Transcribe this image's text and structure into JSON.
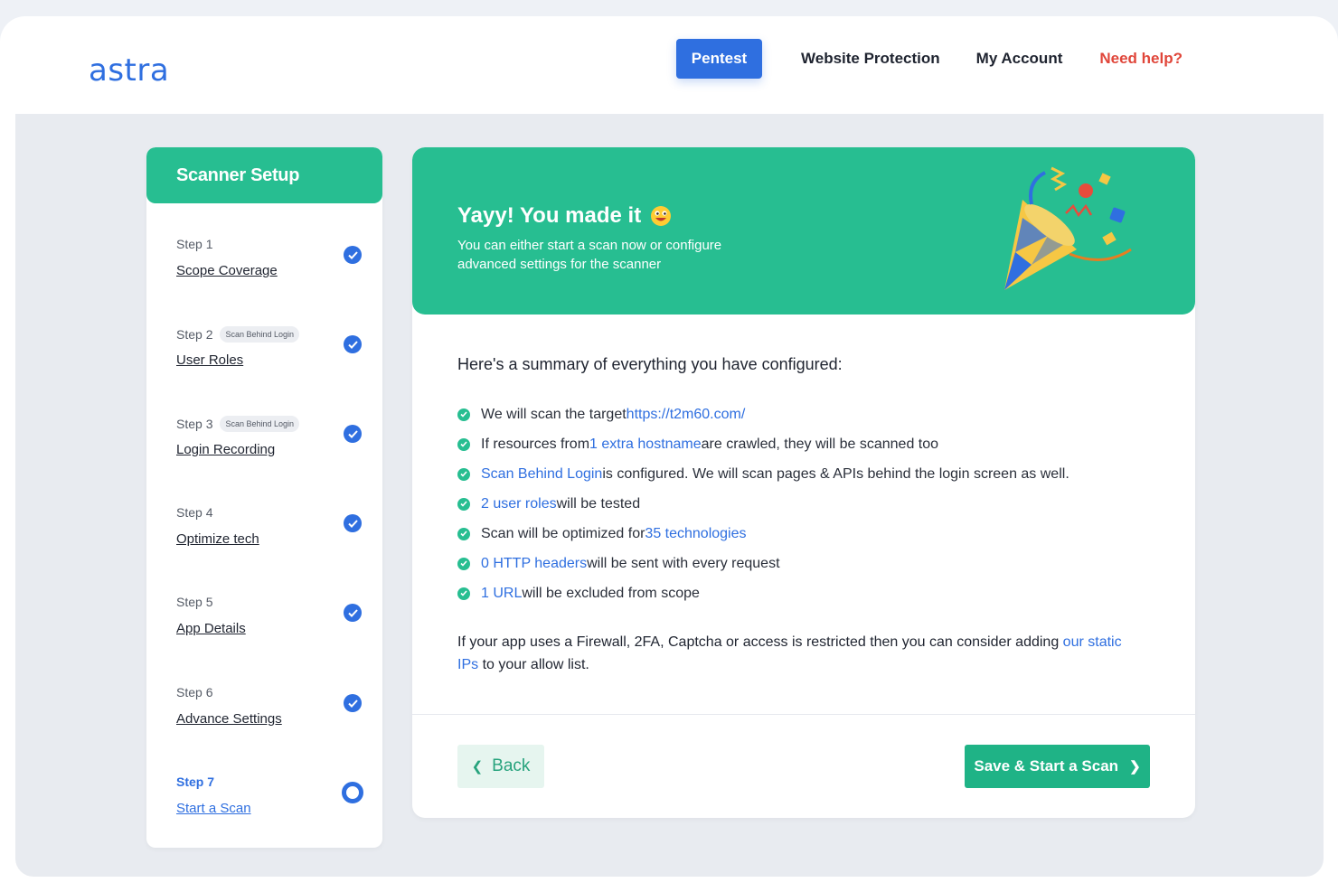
{
  "brand": {
    "logo_text": "astra",
    "accent": "#2f6fe0",
    "green": "#27be91",
    "help_color": "#e0463a"
  },
  "nav": {
    "pentest": "Pentest",
    "website_protection": "Website Protection",
    "my_account": "My Account",
    "need_help": "Need help?"
  },
  "sidebar": {
    "title": "Scanner Setup",
    "steps": [
      {
        "step": "Step 1",
        "badge": "",
        "label": "Scope Coverage",
        "state": "done"
      },
      {
        "step": "Step 2",
        "badge": "Scan Behind Login",
        "label": "User Roles",
        "state": "done"
      },
      {
        "step": "Step 3",
        "badge": "Scan Behind Login",
        "label": "Login Recording",
        "state": "done"
      },
      {
        "step": "Step 4",
        "badge": "",
        "label": "Optimize tech",
        "state": "done"
      },
      {
        "step": "Step 5",
        "badge": "",
        "label": "App Details",
        "state": "done"
      },
      {
        "step": "Step 6",
        "badge": "",
        "label": "Advance Settings",
        "state": "done"
      },
      {
        "step": "Step 7",
        "badge": "",
        "label": "Start a Scan",
        "state": "active"
      }
    ]
  },
  "banner": {
    "title": "Yayy! You made it",
    "subtitle": "You can either start a scan now or configure advanced settings for the scanner",
    "emoji_icon": "grinning-face-icon",
    "illustration_icon": "party-popper-icon"
  },
  "summary": {
    "title": "Here's a summary of everything you have configured:",
    "items": [
      {
        "pre": "We will scan the target ",
        "link": "https://t2m60.com/",
        "post": ""
      },
      {
        "pre": "If resources from ",
        "link": "1 extra hostname",
        "post": " are crawled, they will be scanned too"
      },
      {
        "pre": "",
        "link": "Scan Behind Login",
        "post": " is configured. We will scan pages & APIs behind the login screen as well."
      },
      {
        "pre": "",
        "link": "2 user roles",
        "post": " will be tested"
      },
      {
        "pre": "Scan will be optimized for ",
        "link": "35 technologies",
        "post": ""
      },
      {
        "pre": "",
        "link": "0 HTTP headers",
        "post": " will be sent with every request"
      },
      {
        "pre": "",
        "link": "1 URL",
        "post": " will be excluded from scope"
      }
    ],
    "note_pre": "If your app uses a Firewall, 2FA, Captcha or access is restricted then you can consider adding ",
    "note_link": "our static IPs",
    "note_post": " to your allow list."
  },
  "actions": {
    "back": "Back",
    "start": "Save & Start a Scan"
  }
}
